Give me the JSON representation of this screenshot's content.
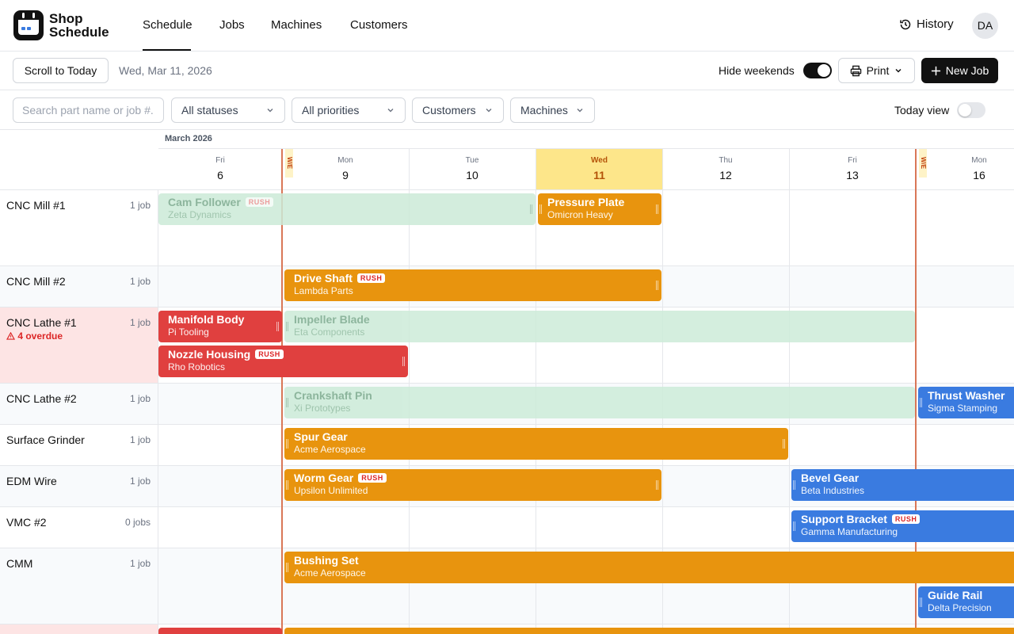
{
  "app": {
    "name_line1": "Shop",
    "name_line2": "Schedule"
  },
  "nav": {
    "tabs": [
      "Schedule",
      "Jobs",
      "Machines",
      "Customers"
    ],
    "history": "History",
    "avatar": "DA"
  },
  "toolbar": {
    "scroll_today": "Scroll to Today",
    "current_date": "Wed, Mar 11, 2026",
    "hide_weekends": "Hide weekends",
    "hide_weekends_on": true,
    "print": "Print",
    "new_job": "New Job"
  },
  "filters": {
    "search_placeholder": "Search part name or job #...",
    "status": "All statuses",
    "priority": "All priorities",
    "customers": "Customers",
    "machines": "Machines",
    "today_view": "Today view",
    "today_view_on": false
  },
  "calendar": {
    "month": "March 2026",
    "weekend_marker": "W/E",
    "days": [
      {
        "dow": "Fri",
        "num": "6"
      },
      {
        "dow": "Mon",
        "num": "9"
      },
      {
        "dow": "Tue",
        "num": "10"
      },
      {
        "dow": "Wed",
        "num": "11",
        "today": true
      },
      {
        "dow": "Thu",
        "num": "12"
      },
      {
        "dow": "Fri",
        "num": "13"
      },
      {
        "dow": "Mon",
        "num": "16"
      }
    ]
  },
  "rush_label": "RUSH",
  "machines": [
    {
      "name": "CNC Mill #1",
      "count": "1 job",
      "jobs": [
        {
          "title": "Cam Follower",
          "customer": "Zeta Dynamics",
          "rush": true,
          "status": "ghost"
        },
        {
          "title": "Pressure Plate",
          "customer": "Omicron Heavy",
          "rush": false,
          "status": "orange"
        }
      ]
    },
    {
      "name": "CNC Mill #2",
      "count": "1 job",
      "jobs": [
        {
          "title": "Drive Shaft",
          "customer": "Lambda Parts",
          "rush": true,
          "status": "orange"
        }
      ]
    },
    {
      "name": "CNC Lathe #1",
      "count": "1 job",
      "overdue": "4 overdue",
      "jobs": [
        {
          "title": "Manifold Body",
          "customer": "Pi Tooling",
          "rush": false,
          "status": "red"
        },
        {
          "title": "Impeller Blade",
          "customer": "Eta Components",
          "rush": false,
          "status": "ghost"
        },
        {
          "title": "Nozzle Housing",
          "customer": "Rho Robotics",
          "rush": true,
          "status": "red"
        }
      ]
    },
    {
      "name": "CNC Lathe #2",
      "count": "1 job",
      "jobs": [
        {
          "title": "Crankshaft Pin",
          "customer": "Xi Prototypes",
          "rush": false,
          "status": "ghost"
        },
        {
          "title": "Thrust Washer",
          "customer": "Sigma Stamping",
          "rush": false,
          "status": "blue"
        }
      ]
    },
    {
      "name": "Surface Grinder",
      "count": "1 job",
      "jobs": [
        {
          "title": "Spur Gear",
          "customer": "Acme Aerospace",
          "rush": false,
          "status": "orange"
        }
      ]
    },
    {
      "name": "EDM Wire",
      "count": "1 job",
      "jobs": [
        {
          "title": "Worm Gear",
          "customer": "Upsilon Unlimited",
          "rush": true,
          "status": "orange"
        },
        {
          "title": "Bevel Gear",
          "customer": "Beta Industries",
          "rush": false,
          "status": "blue"
        }
      ]
    },
    {
      "name": "VMC #2",
      "count": "0 jobs",
      "jobs": [
        {
          "title": "Support Bracket",
          "customer": "Gamma Manufacturing",
          "rush": true,
          "status": "blue"
        }
      ]
    },
    {
      "name": "CMM",
      "count": "1 job",
      "jobs": [
        {
          "title": "Bushing Set",
          "customer": "Acme Aerospace",
          "rush": false,
          "status": "orange"
        },
        {
          "title": "Guide Rail",
          "customer": "Delta Precision",
          "rush": false,
          "status": "blue"
        }
      ]
    }
  ]
}
